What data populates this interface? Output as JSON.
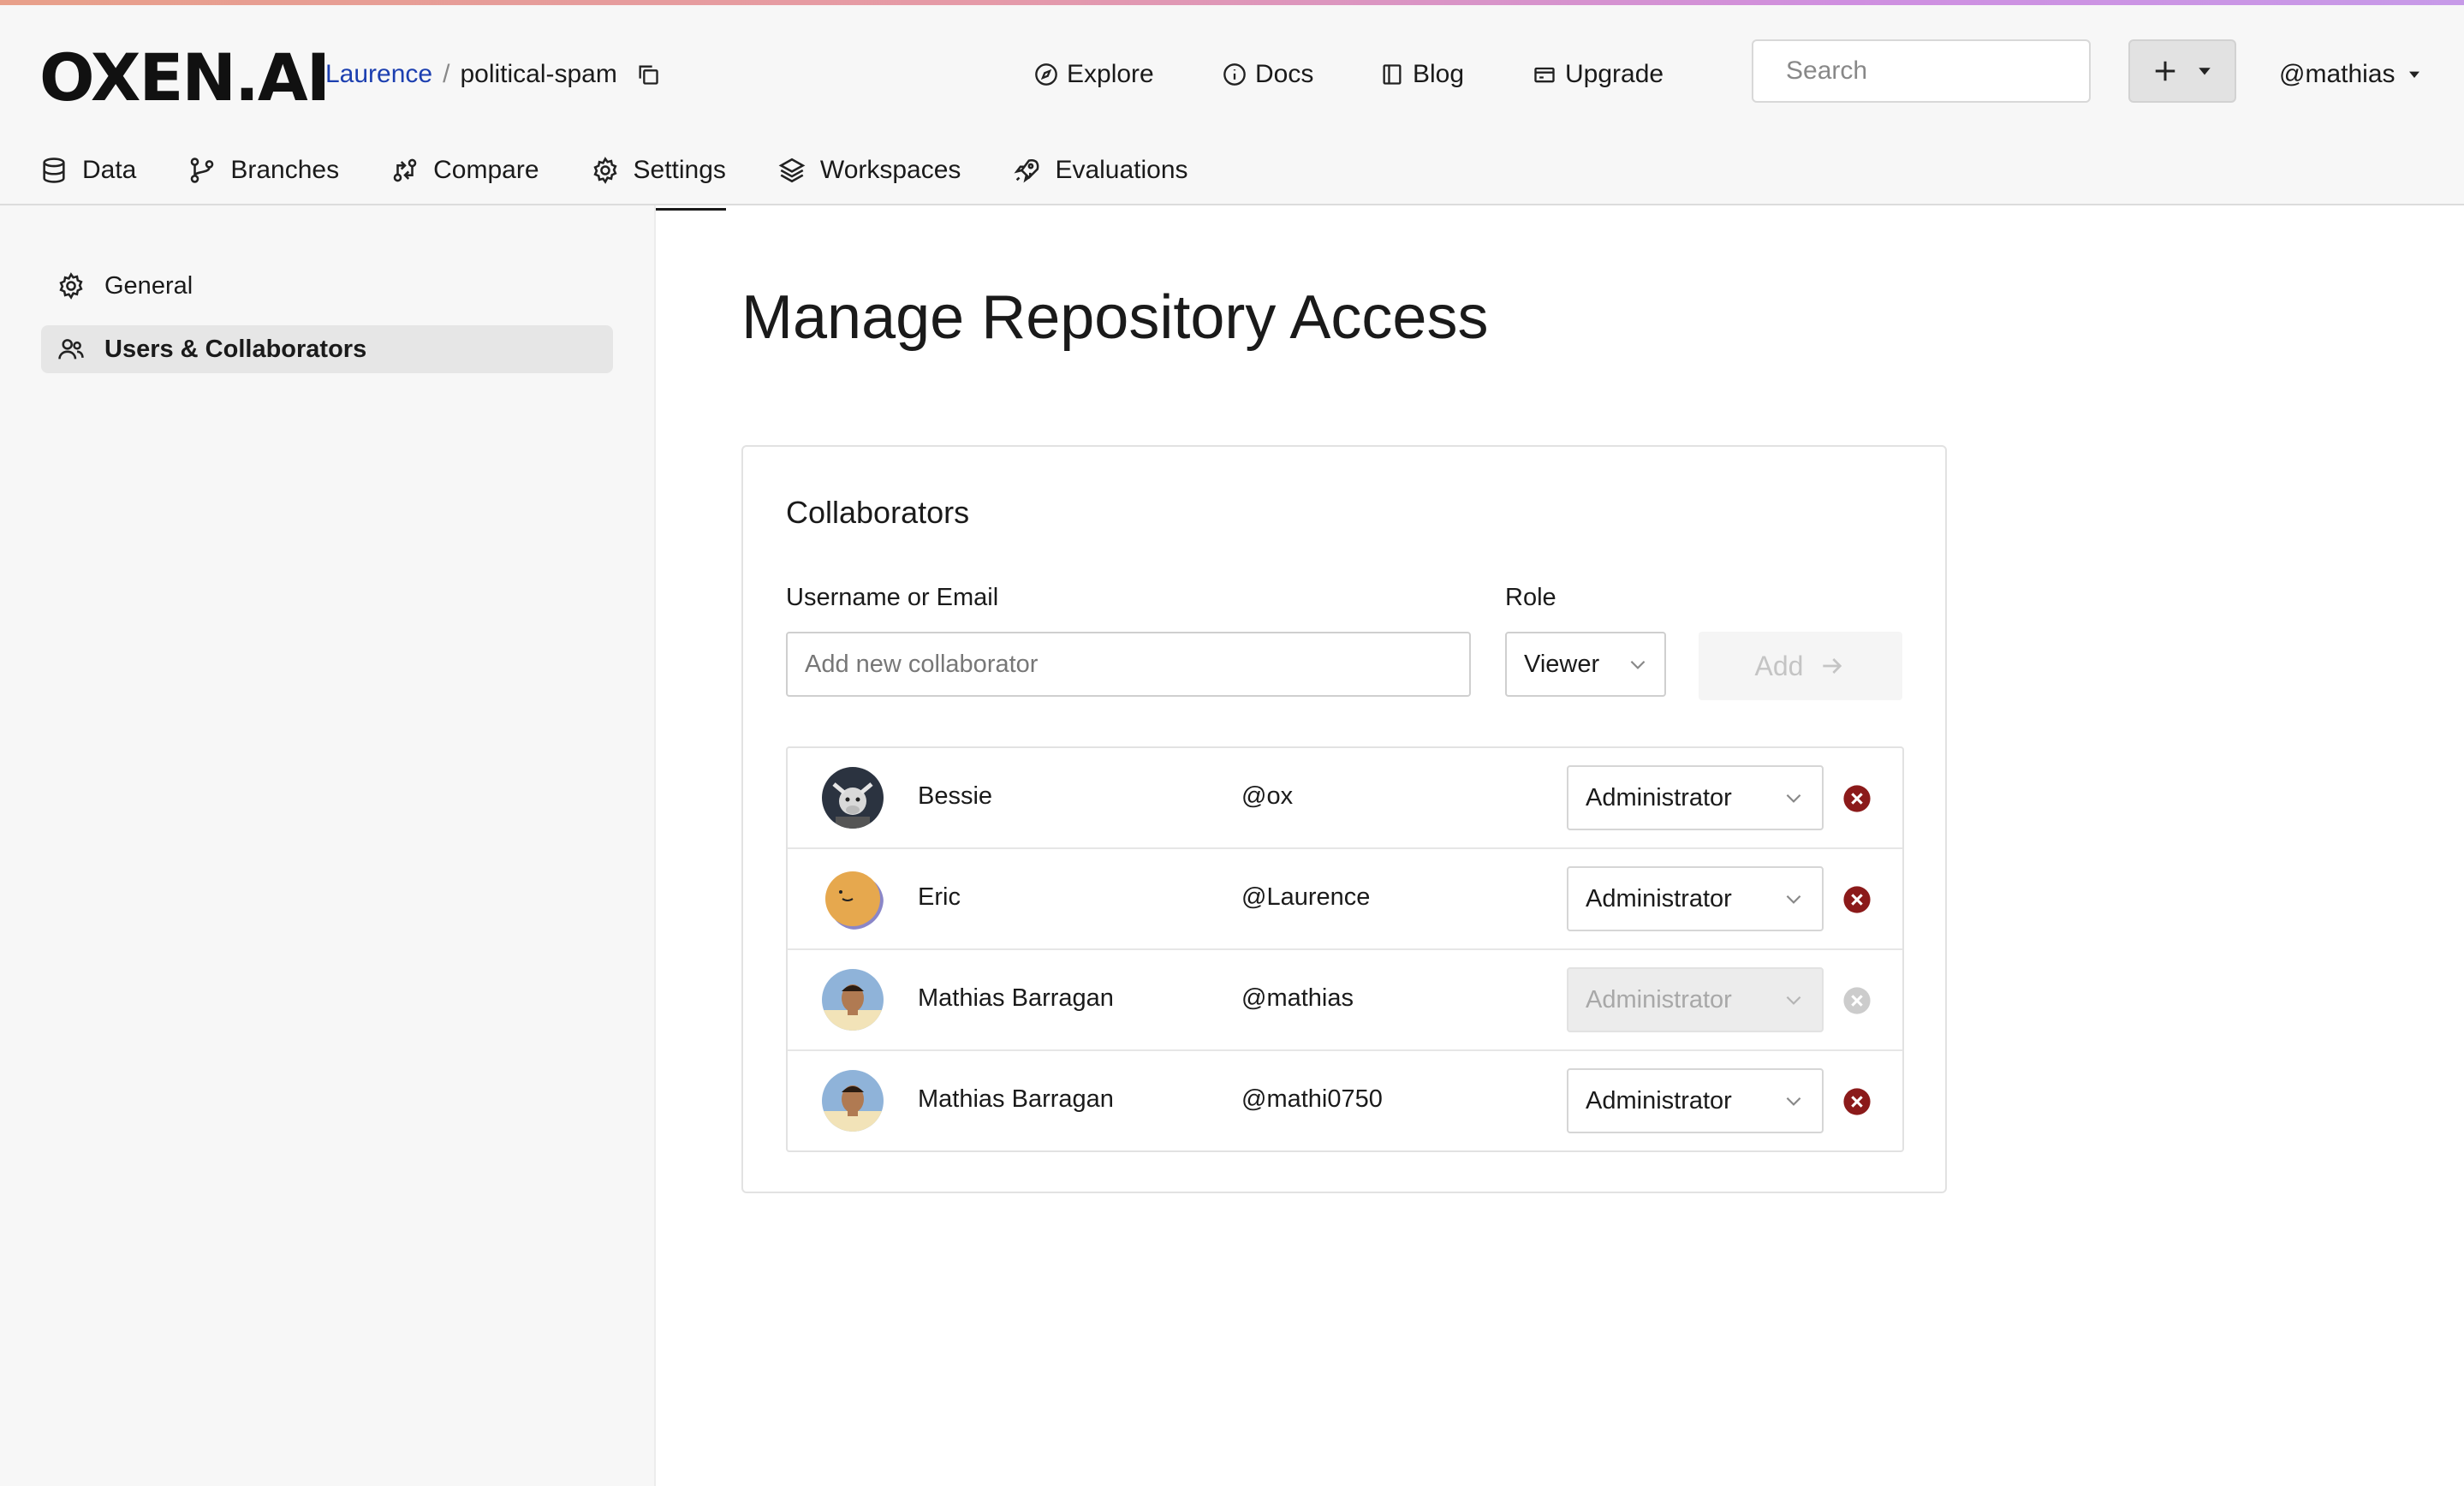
{
  "brand": {
    "logo": "OXEN.AI"
  },
  "breadcrumb": {
    "owner": "Laurence",
    "separator": "/",
    "repo": "political-spam"
  },
  "topnav": {
    "explore": "Explore",
    "docs": "Docs",
    "blog": "Blog",
    "upgrade": "Upgrade"
  },
  "search": {
    "placeholder": "Search"
  },
  "user": {
    "handle": "@mathias"
  },
  "tabs": [
    {
      "label": "Data",
      "icon": "database-icon"
    },
    {
      "label": "Branches",
      "icon": "branch-icon"
    },
    {
      "label": "Compare",
      "icon": "compare-icon"
    },
    {
      "label": "Settings",
      "icon": "gear-icon",
      "active": true
    },
    {
      "label": "Workspaces",
      "icon": "layers-icon"
    },
    {
      "label": "Evaluations",
      "icon": "rocket-icon"
    }
  ],
  "sidebar": {
    "items": [
      {
        "label": "General",
        "icon": "gear-icon"
      },
      {
        "label": "Users & Collaborators",
        "icon": "users-icon",
        "active": true
      }
    ]
  },
  "page": {
    "title": "Manage Repository Access"
  },
  "collaborators": {
    "title": "Collaborators",
    "username_label": "Username or Email",
    "role_label": "Role",
    "input_placeholder": "Add new collaborator",
    "role_value": "Viewer",
    "add_label": "Add",
    "rows": [
      {
        "name": "Bessie",
        "handle": "@ox",
        "role": "Administrator",
        "disabled": false
      },
      {
        "name": "Eric",
        "handle": "@Laurence",
        "role": "Administrator",
        "disabled": false
      },
      {
        "name": "Mathias Barragan",
        "handle": "@mathias",
        "role": "Administrator",
        "disabled": true
      },
      {
        "name": "Mathias Barragan",
        "handle": "@mathi0750",
        "role": "Administrator",
        "disabled": false
      }
    ]
  },
  "colors": {
    "link": "#1c3fb0",
    "remove": "#8b1a1a",
    "remove_disabled": "#cccccc"
  }
}
